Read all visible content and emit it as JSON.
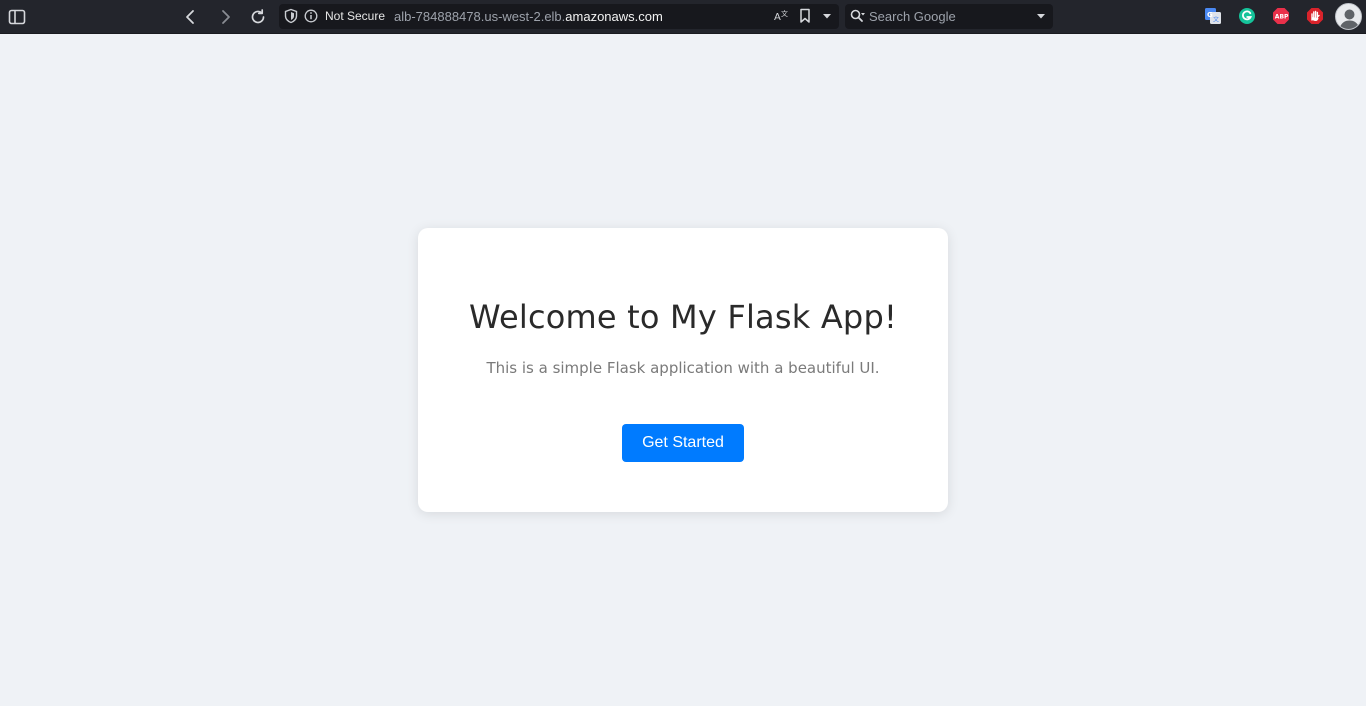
{
  "browser": {
    "security_label": "Not Secure",
    "url_prefix": "alb-784888478.us-west-2.elb.",
    "url_host": "amazonaws.com",
    "search_placeholder": "Search Google",
    "extensions": [
      "google-translate",
      "grammarly",
      "adblock-plus",
      "stop-hand"
    ]
  },
  "page": {
    "heading": "Welcome to My Flask App!",
    "subtitle": "This is a simple Flask application with a beautiful UI.",
    "cta_label": "Get Started"
  },
  "colors": {
    "page_background": "#eff2f6",
    "card_background": "#ffffff",
    "cta_background": "#007bff",
    "toolbar_background": "#23252c"
  }
}
